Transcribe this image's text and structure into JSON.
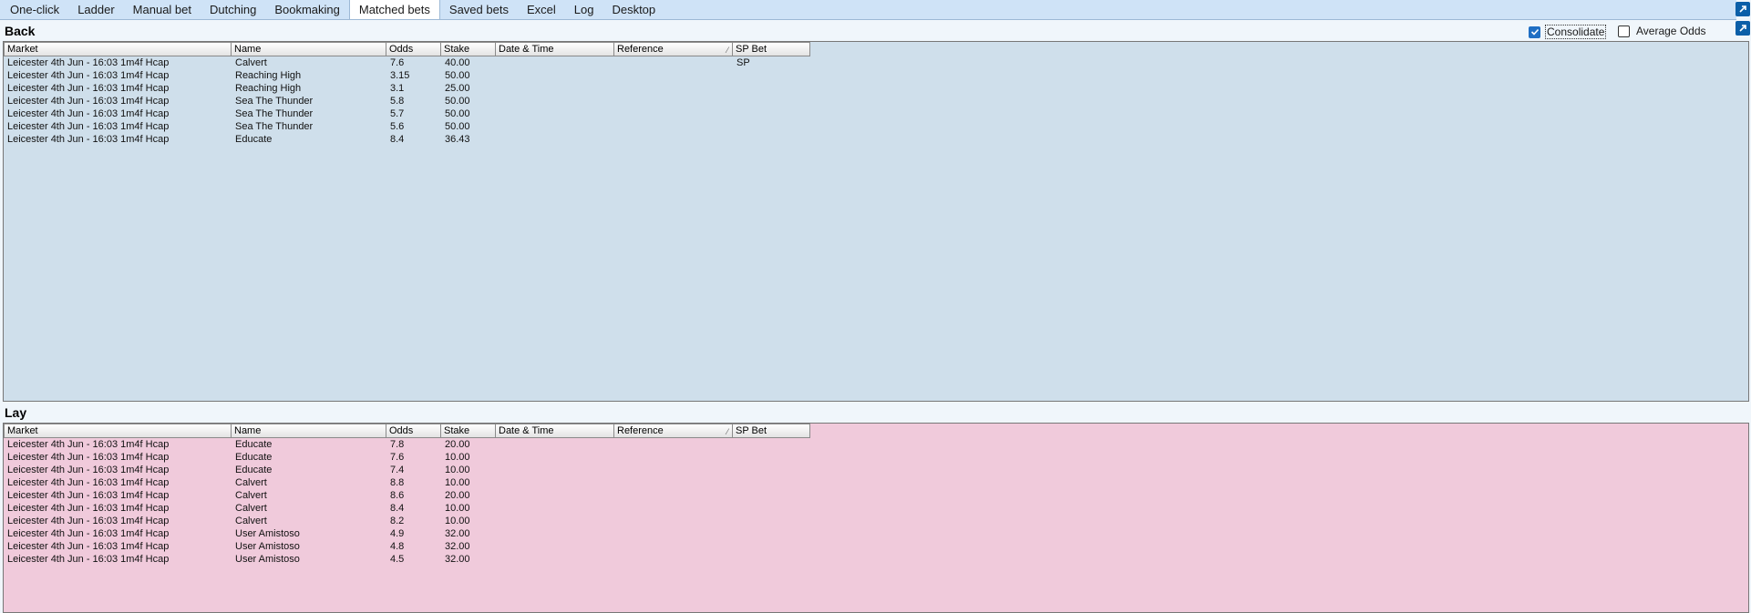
{
  "tabs": [
    {
      "label": "One-click",
      "active": false
    },
    {
      "label": "Ladder",
      "active": false
    },
    {
      "label": "Manual bet",
      "active": false
    },
    {
      "label": "Dutching",
      "active": false
    },
    {
      "label": "Bookmaking",
      "active": false
    },
    {
      "label": "Matched bets",
      "active": true
    },
    {
      "label": "Saved bets",
      "active": false
    },
    {
      "label": "Excel",
      "active": false
    },
    {
      "label": "Log",
      "active": false
    },
    {
      "label": "Desktop",
      "active": false
    }
  ],
  "options": {
    "consolidate": {
      "label": "Consolidate",
      "checked": true
    },
    "average_odds": {
      "label": "Average Odds",
      "checked": false
    }
  },
  "columns": {
    "market": "Market",
    "name": "Name",
    "odds": "Odds",
    "stake": "Stake",
    "datetime": "Date & Time",
    "reference": "Reference",
    "sp_bet": "SP Bet"
  },
  "back": {
    "title": "Back",
    "rows": [
      {
        "market": "Leicester 4th Jun - 16:03 1m4f Hcap",
        "name": "Calvert",
        "odds": "7.6",
        "stake": "40.00",
        "datetime": "",
        "reference": "",
        "sp_bet": "SP"
      },
      {
        "market": "Leicester 4th Jun - 16:03 1m4f Hcap",
        "name": "Reaching High",
        "odds": "3.15",
        "stake": "50.00",
        "datetime": "",
        "reference": "",
        "sp_bet": ""
      },
      {
        "market": "Leicester 4th Jun - 16:03 1m4f Hcap",
        "name": "Reaching High",
        "odds": "3.1",
        "stake": "25.00",
        "datetime": "",
        "reference": "",
        "sp_bet": ""
      },
      {
        "market": "Leicester 4th Jun - 16:03 1m4f Hcap",
        "name": "Sea The Thunder",
        "odds": "5.8",
        "stake": "50.00",
        "datetime": "",
        "reference": "",
        "sp_bet": ""
      },
      {
        "market": "Leicester 4th Jun - 16:03 1m4f Hcap",
        "name": "Sea The Thunder",
        "odds": "5.7",
        "stake": "50.00",
        "datetime": "",
        "reference": "",
        "sp_bet": ""
      },
      {
        "market": "Leicester 4th Jun - 16:03 1m4f Hcap",
        "name": "Sea The Thunder",
        "odds": "5.6",
        "stake": "50.00",
        "datetime": "",
        "reference": "",
        "sp_bet": ""
      },
      {
        "market": "Leicester 4th Jun - 16:03 1m4f Hcap",
        "name": "Educate",
        "odds": "8.4",
        "stake": "36.43",
        "datetime": "",
        "reference": "",
        "sp_bet": ""
      }
    ]
  },
  "lay": {
    "title": "Lay",
    "rows": [
      {
        "market": "Leicester 4th Jun - 16:03 1m4f Hcap",
        "name": "Educate",
        "odds": "7.8",
        "stake": "20.00",
        "datetime": "",
        "reference": "",
        "sp_bet": ""
      },
      {
        "market": "Leicester 4th Jun - 16:03 1m4f Hcap",
        "name": "Educate",
        "odds": "7.6",
        "stake": "10.00",
        "datetime": "",
        "reference": "",
        "sp_bet": ""
      },
      {
        "market": "Leicester 4th Jun - 16:03 1m4f Hcap",
        "name": "Educate",
        "odds": "7.4",
        "stake": "10.00",
        "datetime": "",
        "reference": "",
        "sp_bet": ""
      },
      {
        "market": "Leicester 4th Jun - 16:03 1m4f Hcap",
        "name": "Calvert",
        "odds": "8.8",
        "stake": "10.00",
        "datetime": "",
        "reference": "",
        "sp_bet": ""
      },
      {
        "market": "Leicester 4th Jun - 16:03 1m4f Hcap",
        "name": "Calvert",
        "odds": "8.6",
        "stake": "20.00",
        "datetime": "",
        "reference": "",
        "sp_bet": ""
      },
      {
        "market": "Leicester 4th Jun - 16:03 1m4f Hcap",
        "name": "Calvert",
        "odds": "8.4",
        "stake": "10.00",
        "datetime": "",
        "reference": "",
        "sp_bet": ""
      },
      {
        "market": "Leicester 4th Jun - 16:03 1m4f Hcap",
        "name": "Calvert",
        "odds": "8.2",
        "stake": "10.00",
        "datetime": "",
        "reference": "",
        "sp_bet": ""
      },
      {
        "market": "Leicester 4th Jun - 16:03 1m4f Hcap",
        "name": "User Amistoso",
        "odds": "4.9",
        "stake": "32.00",
        "datetime": "",
        "reference": "",
        "sp_bet": ""
      },
      {
        "market": "Leicester 4th Jun - 16:03 1m4f Hcap",
        "name": "User Amistoso",
        "odds": "4.8",
        "stake": "32.00",
        "datetime": "",
        "reference": "",
        "sp_bet": ""
      },
      {
        "market": "Leicester 4th Jun - 16:03 1m4f Hcap",
        "name": "User Amistoso",
        "odds": "4.5",
        "stake": "32.00",
        "datetime": "",
        "reference": "",
        "sp_bet": ""
      }
    ]
  }
}
